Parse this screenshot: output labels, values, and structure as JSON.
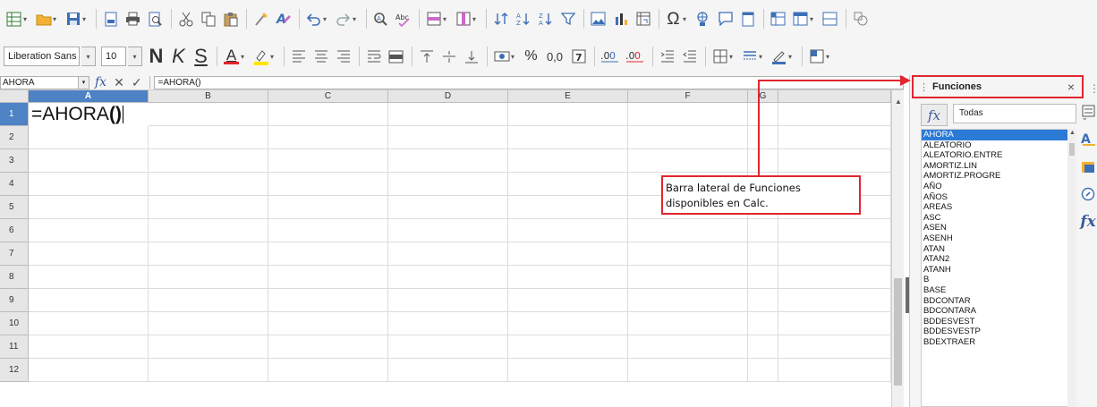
{
  "toolbar1": {
    "icons": [
      "grid-icon",
      "open-folder-icon",
      "save-icon",
      "export-pdf-icon",
      "print-icon",
      "print-preview-icon",
      "cut-icon",
      "copy-icon",
      "paste-icon",
      "clone-formatting-icon",
      "clear-formatting-icon",
      "undo-icon",
      "redo-icon",
      "find-replace-icon",
      "spelling-icon",
      "row-icon",
      "column-icon",
      "sort-icon",
      "sort-ascending-icon",
      "sort-descending-icon",
      "autofilter-icon",
      "insert-image-icon",
      "insert-chart-icon",
      "pivot-table-icon",
      "special-character-icon",
      "hyperlink-icon",
      "comment-icon",
      "headers-footers-icon",
      "define-print-area-icon",
      "freeze-rows-columns-icon",
      "split-window-icon",
      "show-draw-functions-icon"
    ]
  },
  "toolbar2": {
    "font_name": "Liberation Sans",
    "font_size": "10",
    "bold_label": "N",
    "italic_label": "K",
    "underline_label": "S",
    "font_color_label": "A",
    "font_color": "#e0262e",
    "highlight_color": "#ffe600",
    "currency_label": "▪",
    "percent_label": "%",
    "number_format_label": "0,0",
    "date_label": "7",
    "add_decimal_label": ".0",
    "del_decimal_label": ".0"
  },
  "formula_bar": {
    "name_box": "AHORA",
    "fx_label": "fx",
    "cancel_label": "✕",
    "accept_label": "✓",
    "formula": "=AHORA()"
  },
  "grid": {
    "columns": [
      "A",
      "B",
      "C",
      "D",
      "E",
      "F",
      "G"
    ],
    "rows": [
      "1",
      "2",
      "3",
      "4",
      "5",
      "6",
      "7",
      "8",
      "9",
      "10",
      "11",
      "12"
    ],
    "active_column": "A",
    "active_row": "1",
    "cell_a1_prefix": "=AHORA",
    "cell_a1_parens": "()"
  },
  "sidebar": {
    "title": "Funciones",
    "close_label": "×",
    "fx_button": "fx",
    "category": "Todas",
    "functions": [
      "AHORA",
      "ALEATORIO",
      "ALEATORIO.ENTRE",
      "AMORTIZ.LIN",
      "AMORTIZ.PROGRE",
      "AÑO",
      "AÑOS",
      "AREAS",
      "ASC",
      "ASEN",
      "ASENH",
      "ATAN",
      "ATAN2",
      "ATANH",
      "B",
      "BASE",
      "BDCONTAR",
      "BDCONTARA",
      "BDDESVEST",
      "BDDESVESTP",
      "BDEXTRAER"
    ],
    "selected_function": "AHORA",
    "tab_icons": [
      "properties-icon",
      "styles-icon",
      "gallery-icon",
      "navigator-icon",
      "functions-icon"
    ]
  },
  "annotation": {
    "text_line1": "Barra lateral de Funciones",
    "text_line2": "disponibles en Calc.",
    "color": "#e0262e"
  }
}
